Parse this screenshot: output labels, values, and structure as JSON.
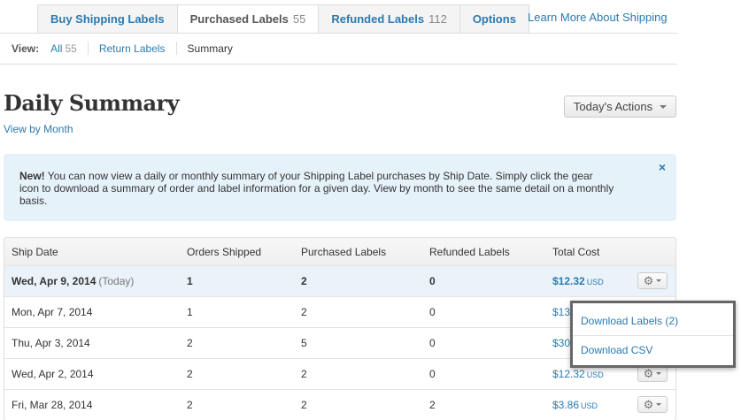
{
  "tabs": [
    {
      "label": "Buy Shipping Labels",
      "count": ""
    },
    {
      "label": "Purchased Labels",
      "count": "55"
    },
    {
      "label": "Refunded Labels",
      "count": "112"
    },
    {
      "label": "Options",
      "count": ""
    }
  ],
  "learn_more": "Learn More About Shipping",
  "subnav": {
    "view_label": "View:",
    "all_label": "All",
    "all_count": "55",
    "return_labels": "Return Labels",
    "summary": "Summary"
  },
  "page": {
    "title": "Daily Summary",
    "view_by_month": "View by Month",
    "actions_button": "Today's Actions"
  },
  "notice": {
    "bold": "New!",
    "text": " You can now view a daily or monthly summary of your Shipping Label purchases by Ship Date. Simply click the gear icon to download a summary of order and label information for a given day. View by month to see the same detail on a monthly basis.",
    "close": "×"
  },
  "table": {
    "headers": [
      "Ship Date",
      "Orders Shipped",
      "Purchased Labels",
      "Refunded Labels",
      "Total Cost"
    ],
    "currency": "USD",
    "today_note": "(Today)",
    "rows": [
      {
        "date": "Wed, Apr 9, 2014",
        "orders": "1",
        "purchased": "2",
        "refunded": "0",
        "cost": "$12.32"
      },
      {
        "date": "Mon, Apr 7, 2014",
        "orders": "1",
        "purchased": "2",
        "refunded": "0",
        "cost": "$13."
      },
      {
        "date": "Thu, Apr 3, 2014",
        "orders": "2",
        "purchased": "5",
        "refunded": "0",
        "cost": "$30."
      },
      {
        "date": "Wed, Apr 2, 2014",
        "orders": "2",
        "purchased": "2",
        "refunded": "0",
        "cost": "$12.32"
      },
      {
        "date": "Fri, Mar 28, 2014",
        "orders": "2",
        "purchased": "2",
        "refunded": "2",
        "cost": "$3.86"
      }
    ]
  },
  "dropdown": {
    "items": [
      "Download Labels (2)",
      "Download CSV"
    ]
  },
  "icons": {
    "gear": "gear-icon",
    "caret": "chevron-down-icon",
    "close": "close-icon"
  },
  "colors": {
    "link": "#2a7ab0",
    "notice_bg": "#e6f2fa",
    "today_row_bg": "#eaf3fa"
  }
}
